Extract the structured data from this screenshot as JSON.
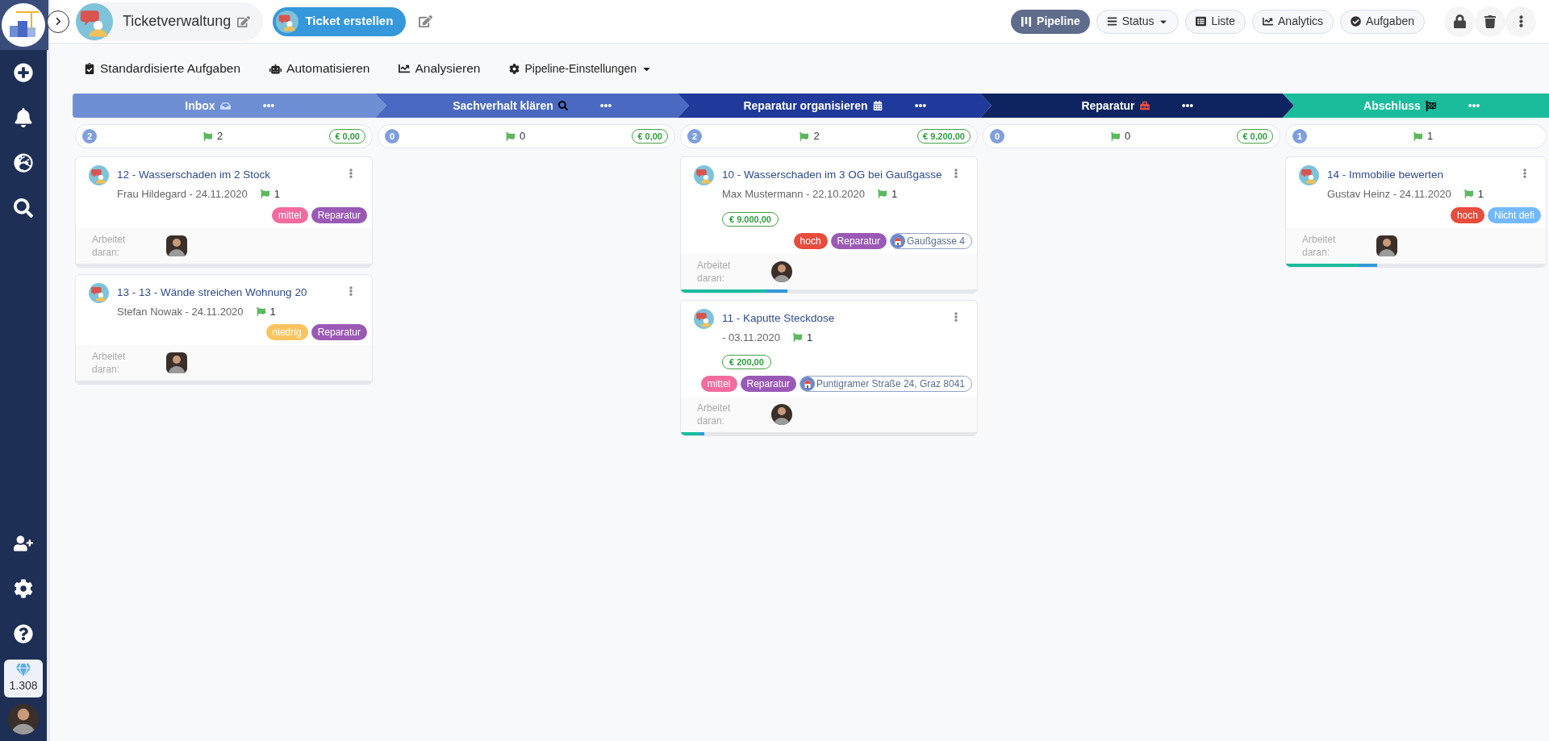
{
  "sidebar": {
    "credits": "1.308"
  },
  "header": {
    "title": "Ticketverwaltung",
    "create_button": "Ticket erstellen",
    "views": [
      {
        "label": "Pipeline",
        "selected": true
      },
      {
        "label": "Status",
        "selected": false,
        "dropdown": true
      },
      {
        "label": "Liste",
        "selected": false
      },
      {
        "label": "Analytics",
        "selected": false
      },
      {
        "label": "Aufgaben",
        "selected": false
      }
    ]
  },
  "toolbar": [
    {
      "label": "Standardisierte Aufgaben"
    },
    {
      "label": "Automatisieren"
    },
    {
      "label": "Analysieren"
    },
    {
      "label": "Pipeline-Einstellungen",
      "dropdown": true
    }
  ],
  "stages": [
    {
      "title": "Inbox",
      "color": "#6f8fd5",
      "count": "2",
      "flags": "2",
      "amount": "€ 0,00",
      "cards": [
        {
          "title": "12 - Wasserschaden im 2 Stock",
          "meta": "Frau Hildegard - 24.11.2020",
          "flags": "1",
          "tags": [
            {
              "label": "mittel",
              "color": "#f36b9f"
            },
            {
              "label": "Reparatur",
              "color": "#9b59b6"
            }
          ],
          "worker_label": "Arbeitet daran:"
        },
        {
          "title": "13 - 13 - Wände streichen Wohnung 20",
          "meta": "Stefan Nowak - 24.11.2020",
          "flags": "1",
          "tags": [
            {
              "label": "niedrig",
              "color": "#f9c45f"
            },
            {
              "label": "Reparatur",
              "color": "#9b59b6"
            }
          ],
          "worker_label": "Arbeitet daran:"
        }
      ]
    },
    {
      "title": "Sachverhalt klären",
      "color": "#4a69c1",
      "count": "0",
      "flags": "0",
      "amount": "€ 0,00"
    },
    {
      "title": "Reparatur organisieren",
      "color": "#1f3a9b",
      "count": "2",
      "flags": "2",
      "amount": "€ 9.200,00",
      "cards": [
        {
          "title": "10 - Wasserschaden im 3 OG bei Gaußgasse",
          "meta": "Max Mustermann - 22.10.2020",
          "flags": "1",
          "amount": "€ 9.000,00",
          "tags": [
            {
              "label": "hoch",
              "color": "#e74c3c"
            },
            {
              "label": "Reparatur",
              "color": "#9b59b6"
            }
          ],
          "address": "Gaußgasse 4",
          "worker_label": "Arbeitet daran:",
          "level": 0.36
        },
        {
          "title": "11 - Kaputte Steckdose",
          "meta": "- 03.11.2020",
          "flags": "1",
          "amount": "€ 200,00",
          "tags": [
            {
              "label": "mittel",
              "color": "#f36b9f"
            },
            {
              "label": "Reparatur",
              "color": "#9b59b6"
            }
          ],
          "address": "Puntigramer Straße 24, Graz 8041",
          "worker_label": "Arbeitet daran:",
          "level": 0.08
        }
      ]
    },
    {
      "title": "Reparatur",
      "color": "#0e2461",
      "count": "0",
      "flags": "0",
      "amount": "€ 0,00"
    },
    {
      "title": "Abschluss",
      "color": "#1abc9c",
      "count": "1",
      "flags": "1",
      "cards": [
        {
          "title": "14 - Immobilie bewerten",
          "meta": "Gustav Heinz - 24.11.2020",
          "flags": "1",
          "tags": [
            {
              "label": "hoch",
              "color": "#e74c3c"
            },
            {
              "label": "Nicht defi",
              "color": "#74b9ff"
            }
          ],
          "worker_label": "Arbeitet daran:",
          "level": 0.35
        }
      ]
    }
  ]
}
